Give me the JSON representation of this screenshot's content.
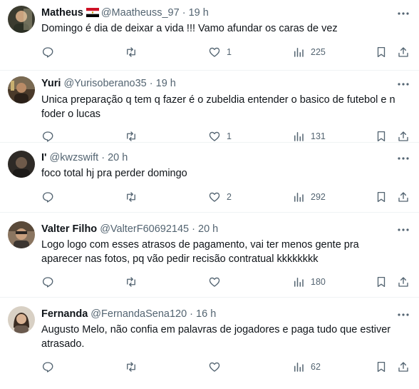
{
  "tweets": [
    {
      "name": "Matheus",
      "has_flag": true,
      "handle": "@Maatheuss_97",
      "time": "19 h",
      "text": "Domingo é dia de deixar a vida !!! Vamo afundar os caras de vez",
      "likes": "1",
      "views": "225",
      "avatar_color": "#3b3b2f"
    },
    {
      "name": "Yuri",
      "has_flag": false,
      "handle": "@Yurisoberano35",
      "time": "19 h",
      "text": "Unica preparação q tem q fazer é o zubeldia entender o basico de futebol e n foder o lucas",
      "likes": "1",
      "views": "131",
      "avatar_color": "#4a3a2a"
    },
    {
      "name": "I'",
      "has_flag": false,
      "handle": "@kwzswift",
      "time": "20 h",
      "text": "foco total hj pra perder domingo",
      "likes": "2",
      "views": "292",
      "avatar_color": "#2e2a26"
    },
    {
      "name": "Valter Filho",
      "has_flag": false,
      "handle": "@ValterF60692145",
      "time": "20 h",
      "text": "Logo logo com esses atrasos de pagamento, vai ter menos gente pra aparecer nas fotos, pq vão pedir recisão contratual kkkkkkkk",
      "likes": "",
      "views": "180",
      "avatar_color": "#6b5a48"
    },
    {
      "name": "Fernanda",
      "has_flag": false,
      "handle": "@FernandaSena120",
      "time": "16 h",
      "text": "Augusto Melo, não confia em palavras de jogadores e paga tudo que estiver atrasado.",
      "likes": "",
      "views": "62",
      "avatar_color": "#a89a88"
    }
  ],
  "colors": {
    "text": "#0f1419",
    "secondary": "#536471",
    "divider": "#eff3f4",
    "flag_red": "#ce1126",
    "flag_black": "#000000"
  }
}
